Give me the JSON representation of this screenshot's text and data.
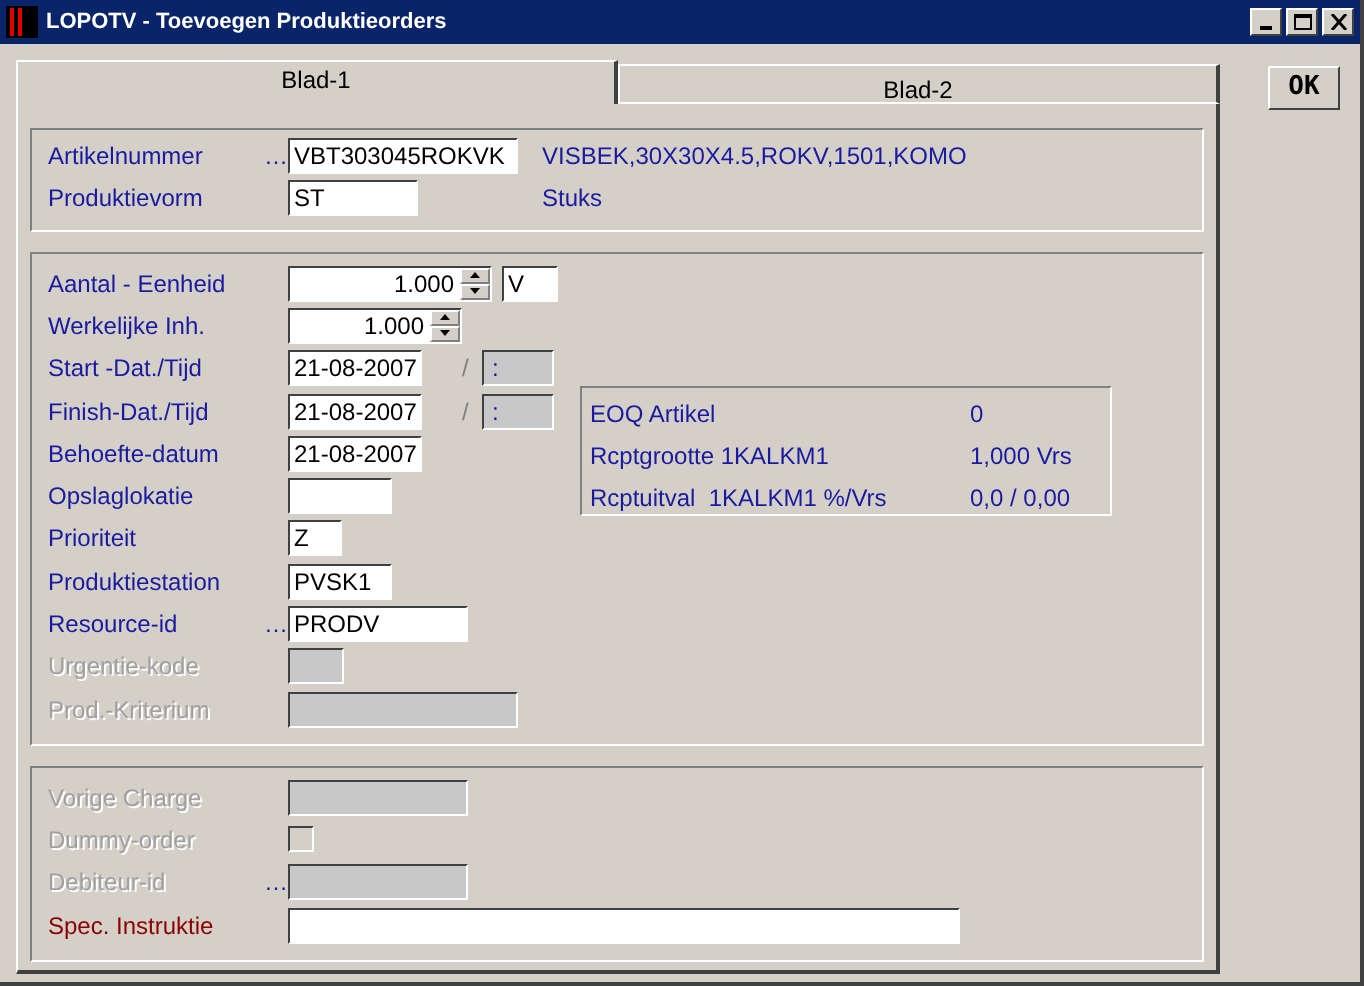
{
  "window": {
    "title": "LOPOTV - Toevoegen Produktieorders"
  },
  "tabs": [
    {
      "label": "Blad-1",
      "selected": true
    },
    {
      "label": "Blad-2",
      "selected": false
    }
  ],
  "ok_button": "OK",
  "groups": [
    {
      "fields": [
        {
          "label": "Artikelnummer",
          "kind": "text",
          "value": "VBT303045ROKVK",
          "disabled": false,
          "required": false,
          "lookup": "…",
          "description": "VISBEK,30X30X4.5,ROKV,1501,KOMO"
        },
        {
          "label": "Produktievorm",
          "kind": "text",
          "value": "ST",
          "disabled": false,
          "required": false,
          "description": "Stuks"
        }
      ]
    },
    {
      "fields": [
        {
          "label": "Aantal - Eenheid",
          "kind": "spinner",
          "value": "1.000",
          "disabled": false,
          "required": false,
          "unit": "V"
        },
        {
          "label": "Werkelijke Inh.",
          "kind": "spinner",
          "value": "1.000",
          "disabled": false,
          "required": false
        },
        {
          "label": "Start -Dat./Tijd",
          "kind": "text",
          "value": "21-08-2007",
          "disabled": false,
          "required": false,
          "separator": "/",
          "time": {
            "value": ":",
            "disabled": true
          }
        },
        {
          "label": "Finish-Dat./Tijd",
          "kind": "text",
          "value": "21-08-2007",
          "disabled": false,
          "required": false,
          "separator": "/",
          "time": {
            "value": ":",
            "disabled": true
          }
        },
        {
          "label": "Behoefte-datum",
          "kind": "text",
          "value": "21-08-2007",
          "disabled": false,
          "required": false
        },
        {
          "label": "Opslaglokatie",
          "kind": "text",
          "disabled": false,
          "required": false
        },
        {
          "label": "Prioriteit",
          "kind": "text",
          "value": "Z",
          "disabled": false,
          "required": false
        },
        {
          "label": "Produktiestation",
          "kind": "text",
          "value": "PVSK1",
          "disabled": false,
          "required": false
        },
        {
          "label": "Resource-id",
          "kind": "text",
          "value": "PRODV",
          "disabled": false,
          "required": false,
          "lookup": "…"
        },
        {
          "label": "Urgentie-kode",
          "kind": "text",
          "disabled": true,
          "required": false
        },
        {
          "label": "Prod.-Kriterium",
          "kind": "text",
          "disabled": true,
          "required": false
        }
      ],
      "info": [
        {
          "label": "EOQ Artikel",
          "value": "0"
        },
        {
          "label": "Rcptgrootte 1KALKM1",
          "value": "1,000 Vrs"
        },
        {
          "label": "Rcptuitval  1KALKM1 %/Vrs",
          "value": "0,0 / 0,00"
        }
      ]
    },
    {
      "fields": [
        {
          "label": "Vorige Charge",
          "kind": "text",
          "disabled": true,
          "required": false
        },
        {
          "label": "Dummy-order",
          "kind": "checkbox",
          "checked": false,
          "disabled": true,
          "required": false
        },
        {
          "label": "Debiteur-id",
          "kind": "text",
          "disabled": true,
          "required": false,
          "lookup": "…"
        },
        {
          "label": "Spec. Instruktie",
          "kind": "text",
          "disabled": false,
          "required": true
        }
      ]
    }
  ]
}
